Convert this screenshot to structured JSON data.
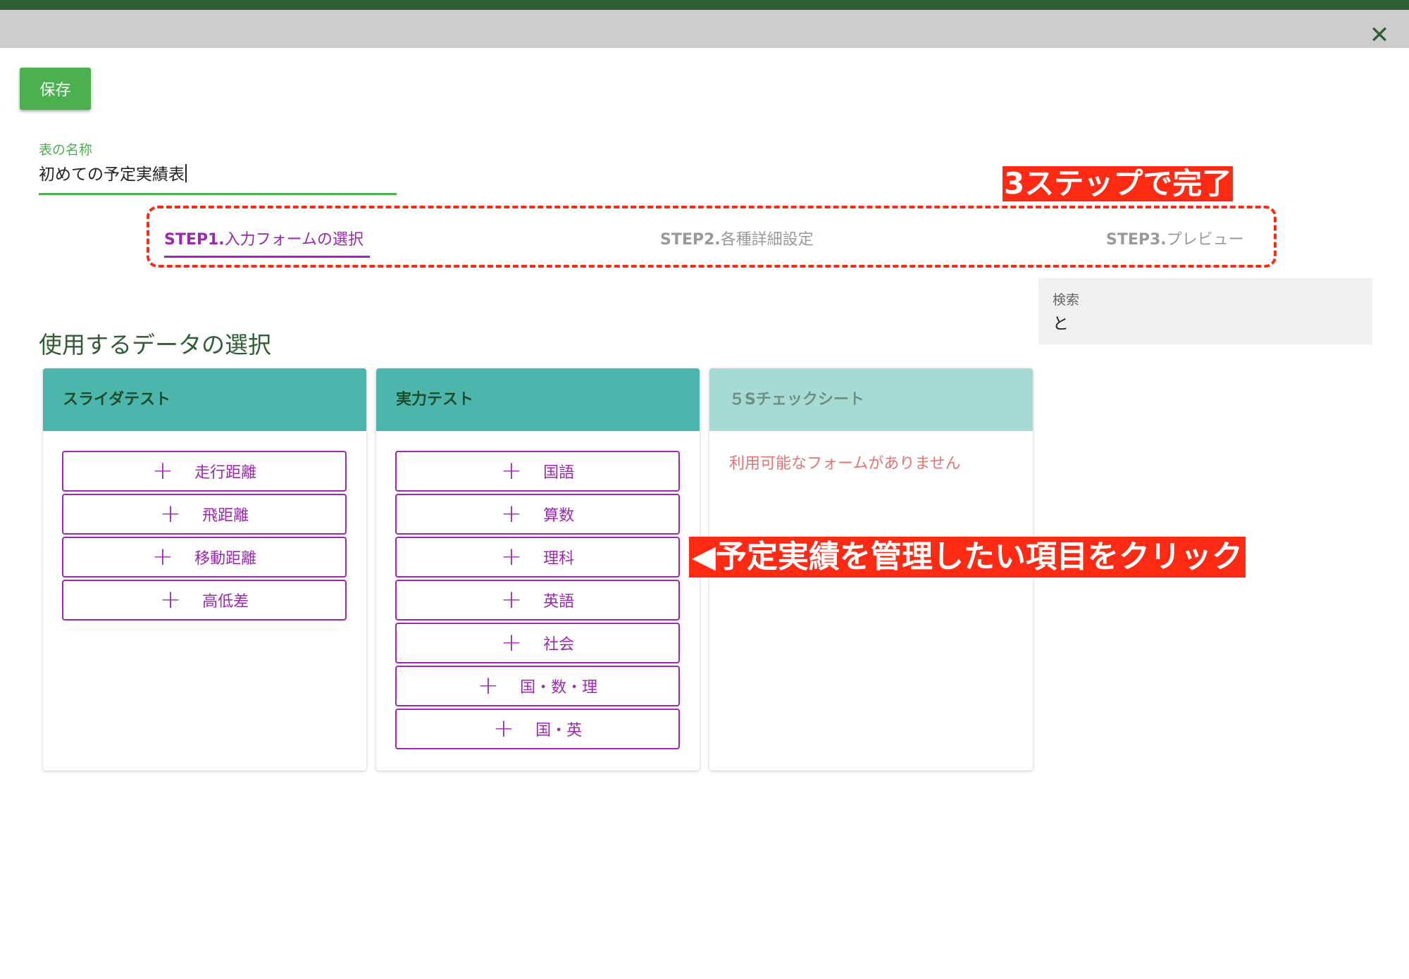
{
  "header": {
    "close_icon": "close-icon",
    "close_glyph": "✕",
    "save_label": "保存"
  },
  "table_name": {
    "label": "表の名称",
    "value": "初めての予定実績表"
  },
  "steps": [
    {
      "prefix": "STEP1.",
      "name": "入力フォームの選択",
      "active": true
    },
    {
      "prefix": "STEP2.",
      "name": "各種詳細設定",
      "active": false
    },
    {
      "prefix": "STEP3.",
      "name": "プレビュー",
      "active": false
    }
  ],
  "annotations": {
    "steps_callout": "3ステップで完了",
    "click_callout": "◀予定実績を管理したい項目をクリック"
  },
  "search": {
    "label": "検索",
    "value": "と"
  },
  "section_title": "使用するデータの選択",
  "colors": {
    "accent_green": "#4caf50",
    "header_green": "#2f5e33",
    "teal": "#4db6ac",
    "purple": "#9c27b0",
    "annotation_red": "#ff2a14"
  },
  "cards": [
    {
      "title": "スライダテスト",
      "items": [
        "走行距離",
        "飛距離",
        "移動距離",
        "高低差"
      ]
    },
    {
      "title": "実力テスト",
      "items": [
        "国語",
        "算数",
        "理科",
        "英語",
        "社会",
        "国・数・理",
        "国・英"
      ]
    },
    {
      "title": "５Sチェックシート",
      "items": [],
      "empty_message": "利用可能なフォームがありません"
    }
  ]
}
